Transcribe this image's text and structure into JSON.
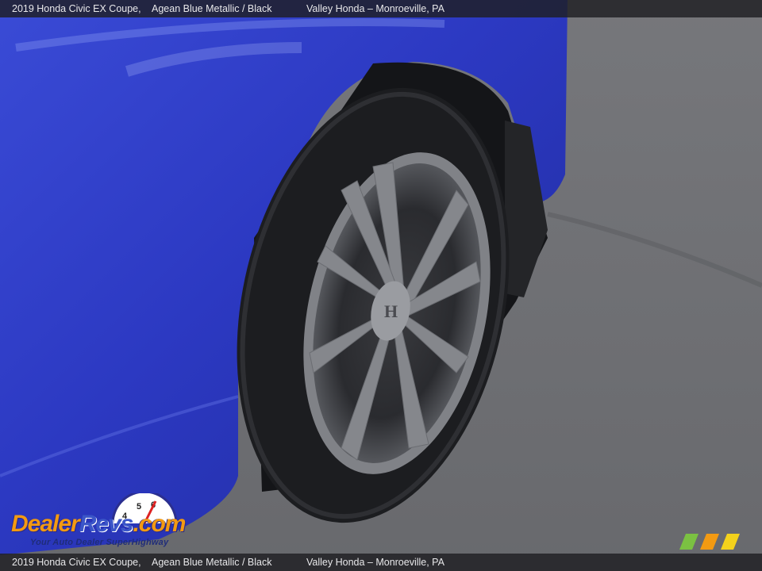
{
  "caption": {
    "vehicle": "2019 Honda Civic EX Coupe,",
    "color": "Agean Blue Metallic  / Black",
    "dealer": "Valley Honda – Monroeville, PA"
  },
  "watermark": {
    "brand_a": "Dealer",
    "brand_b": "Revs",
    "brand_c": ".com",
    "tagline": "Your Auto Dealer SuperHighway"
  },
  "colors": {
    "car_body": "#2f3fc8",
    "asphalt": "#6e6f73",
    "tire": "#1c1d20",
    "rim": "#7d7f84"
  },
  "icons": [
    "dealerrevs-logo",
    "speedometer-icon",
    "color-stripe-mark"
  ]
}
